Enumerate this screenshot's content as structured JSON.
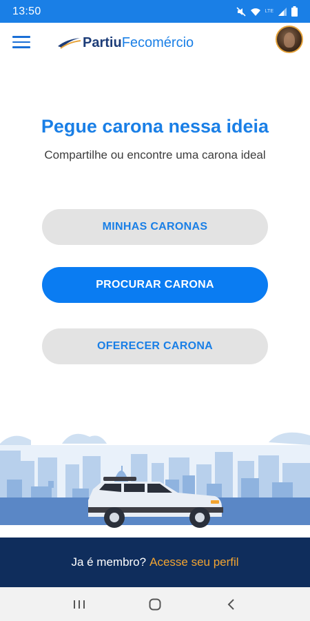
{
  "status_bar": {
    "time": "13:50",
    "icons": [
      "mute-icon",
      "wifi-icon",
      "lte-icon",
      "signal-icon",
      "battery-icon"
    ],
    "lte_label": "LTE"
  },
  "app_bar": {
    "logo_bold": "Partiu",
    "logo_light": "Fecomércio"
  },
  "main": {
    "headline": "Pegue carona nessa ideia",
    "subhead": "Compartilhe ou encontre uma carona ideal",
    "buttons": {
      "minhas": "MINHAS CARONAS",
      "procurar": "PROCURAR CARONA",
      "oferecer": "OFERECER CARONA"
    }
  },
  "footer": {
    "text": "Ja é membro?",
    "link": "Acesse seu perfil"
  },
  "colors": {
    "status_bar": "#1a7fe6",
    "primary": "#0a7cf2",
    "secondary_button": "#e3e3e3",
    "footer": "#0f2d5c",
    "link": "#f2a431"
  }
}
